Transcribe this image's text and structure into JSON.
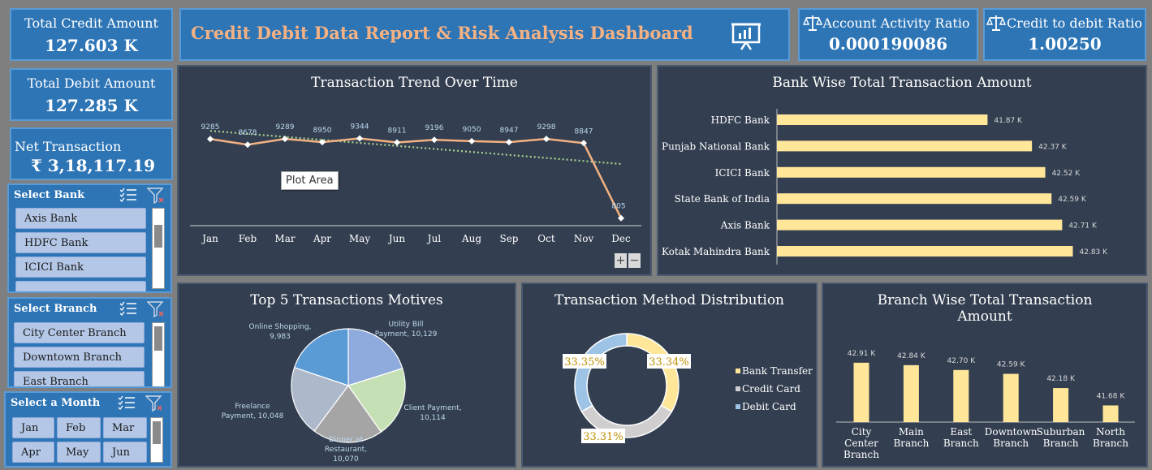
{
  "kpis": {
    "total_credit": {
      "label": "Total Credit Amount",
      "value": "127.603 K"
    },
    "total_debit": {
      "label": "Total Debit Amount",
      "value": "127.285 K"
    },
    "net_transaction": {
      "label": "Net Transaction",
      "value": "₹ 3,18,117.19"
    },
    "activity_ratio": {
      "label": "Account Activity Ratio",
      "value": "0.000190086",
      "icon": "scale-icon"
    },
    "credit_debit_ratio": {
      "label": "Credit to debit Ratio",
      "value": "1.00250",
      "icon": "scale-icon"
    }
  },
  "header": {
    "title": "Credit Debit Data Report & Risk Analysis Dashboard",
    "icon": "presentation-chart-icon"
  },
  "slicers": {
    "bank": {
      "title": "Select Bank",
      "items": [
        "Axis Bank",
        "HDFC Bank",
        "ICICI Bank"
      ]
    },
    "branch": {
      "title": "Select Branch",
      "items": [
        "City Center Branch",
        "Downtown Branch",
        "East Branch"
      ]
    },
    "month": {
      "title": "Select a Month",
      "items": [
        "Jan",
        "Feb",
        "Mar",
        "Apr",
        "May",
        "Jun"
      ]
    }
  },
  "tooltip": "Plot Area",
  "zoom": {
    "plus": "+",
    "minus": "−"
  },
  "colors": {
    "accent_blue": "#2e75b6",
    "panel": "#333f50",
    "trend_line": "#f4b183",
    "trend_fit": "#a9d18e",
    "bar": "#ffe699",
    "header_title": "#f4b183"
  },
  "chart_data": [
    {
      "id": "trend",
      "type": "line",
      "title": "Transaction Trend Over Time",
      "categories": [
        "Jan",
        "Feb",
        "Mar",
        "Apr",
        "May",
        "Jun",
        "Jul",
        "Aug",
        "Sep",
        "Oct",
        "Nov",
        "Dec"
      ],
      "values": [
        9285,
        8678,
        9289,
        8950,
        9344,
        8911,
        9196,
        9050,
        8947,
        9298,
        8847,
        805
      ],
      "labels": [
        "9285",
        "8678",
        "9289",
        "8950",
        "9344",
        "8911",
        "9196",
        "9050",
        "8947",
        "9298",
        "8847",
        "805"
      ],
      "trendline": "linear",
      "ylim": [
        0,
        10500
      ]
    },
    {
      "id": "bank",
      "type": "bar",
      "orientation": "horizontal",
      "title": "Bank Wise Total Transaction Amount",
      "categories": [
        "HDFC Bank",
        "Punjab National Bank",
        "ICICI Bank",
        "State Bank of India",
        "Axis Bank",
        "Kotak Mahindra Bank"
      ],
      "values": [
        41.87,
        42.37,
        42.52,
        42.59,
        42.71,
        42.83
      ],
      "labels": [
        "41.87 K",
        "42.37 K",
        "42.52 K",
        "42.59 K",
        "42.71 K",
        "42.83 K"
      ],
      "xlim": [
        39.5,
        43.2
      ]
    },
    {
      "id": "motives",
      "type": "pie",
      "title": "Top 5 Transactions Motives",
      "categories": [
        "Utility Bill Payment",
        "Client Payment",
        "Dinner at Restaurant",
        "Freelance Payment",
        "Online Shopping"
      ],
      "values": [
        10129,
        10114,
        10070,
        10048,
        9983
      ],
      "labels": [
        [
          "Utility Bill",
          "Payment, 10,129"
        ],
        [
          "Client Payment,",
          "10,114"
        ],
        [
          "Dinner at",
          "Restaurant,",
          "10,070"
        ],
        [
          "Freelance",
          "Payment, 10,048"
        ],
        [
          "Online Shopping,",
          "9,983"
        ]
      ],
      "colors": [
        "#8faadc",
        "#c5e0b4",
        "#a5a5a5",
        "#adb9ca",
        "#5b9bd5"
      ]
    },
    {
      "id": "method",
      "type": "pie",
      "style": "donut",
      "title": "Transaction Method Distribution",
      "categories": [
        "Bank Transfer",
        "Credit Card",
        "Debit Card"
      ],
      "values": [
        33.34,
        33.31,
        33.35
      ],
      "labels": [
        "33.34%",
        "33.31%",
        "33.35%"
      ],
      "colors": [
        "#ffe699",
        "#d0cece",
        "#9dc3e6"
      ],
      "legend": "right"
    },
    {
      "id": "branch",
      "type": "bar",
      "title": "Branch Wise Total Transaction Amount",
      "categories": [
        [
          "City",
          "Center",
          "Branch"
        ],
        [
          "Main",
          "Branch"
        ],
        [
          "East",
          "Branch"
        ],
        [
          "Downtown",
          "Branch"
        ],
        [
          "Suburban",
          "Branch"
        ],
        [
          "North",
          "Branch"
        ]
      ],
      "values": [
        42.91,
        42.84,
        42.7,
        42.59,
        42.18,
        41.68
      ],
      "labels": [
        "42.91 K",
        "42.84 K",
        "42.70 K",
        "42.59 K",
        "42.18 K",
        "41.68 K"
      ],
      "ylim": [
        41.2,
        43.0
      ]
    }
  ]
}
